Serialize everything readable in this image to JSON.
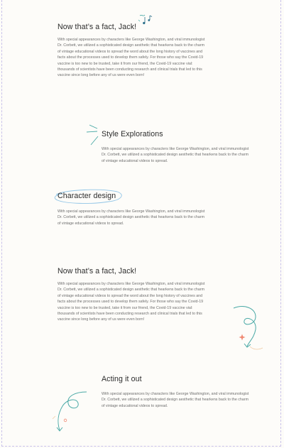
{
  "sections": [
    {
      "title": "Now that’s a fact, Jack!",
      "body": "With special appearances by characters like George Washington, and viral immunologist Dr. Corbett, we utilized a sophisticated design aesthetic that hearkens back to the charm of vintage educational videos to spread the word about the long history of vaccines and facts about the processes used to develop them safely.  For those who say the Covid-19 vaccine is too new to be trusted, take it from our friend, the Covid-19 vaccine vial: thousands of scientists have been conducting research and clinical trials that led to this vaccine since long before any of us were even born!"
    },
    {
      "title": "Style Explorations",
      "body": "With special appearances by characters like George Washington, and viral immunologist Dr. Corbett, we utilized a sophisticated design aesthetic that hearkens back to the charm of vintage educational videos to spread."
    },
    {
      "title": "Character design",
      "body": "With special appearances by characters like George Washington, and viral immunologist Dr. Corbett, we utilized a sophisticated design aesthetic that hearkens back to the charm of vintage educational videos to spread."
    },
    {
      "title": "Now that’s a fact, Jack!",
      "body": "With special appearances by characters like George Washington, and viral immunologist Dr. Corbett, we utilized a sophisticated design aesthetic that hearkens back to the charm of vintage educational videos to spread the word about the long history of vaccines and facts about the processes used to develop them safely.  For those who say the Covid-19 vaccine is too new to be trusted, take it from our friend, the Covid-19 vaccine vial: thousands of scientists have been conducting research and clinical trials that led to this vaccine since long before any of us were even born!"
    },
    {
      "title": "Acting it out",
      "body": "With special appearances by characters like George Washington, and viral immunologist Dr. Corbett, we utilized a sophisticated design aesthetic that hearkens back to the charm of vintage educational videos to spread."
    }
  ],
  "colors": {
    "frame": "#c9c2ea",
    "teal": "#4aa9a6",
    "sky": "#8fc4e6",
    "coral": "#f08a73",
    "heading": "#2b2b2b",
    "text": "#6f6f6f"
  },
  "icons": [
    "music-notes-icon",
    "sparkle-lines-icon",
    "circle-scribble-icon",
    "swirl-arrow-icon",
    "star-icon",
    "loop-arrow-icon"
  ]
}
